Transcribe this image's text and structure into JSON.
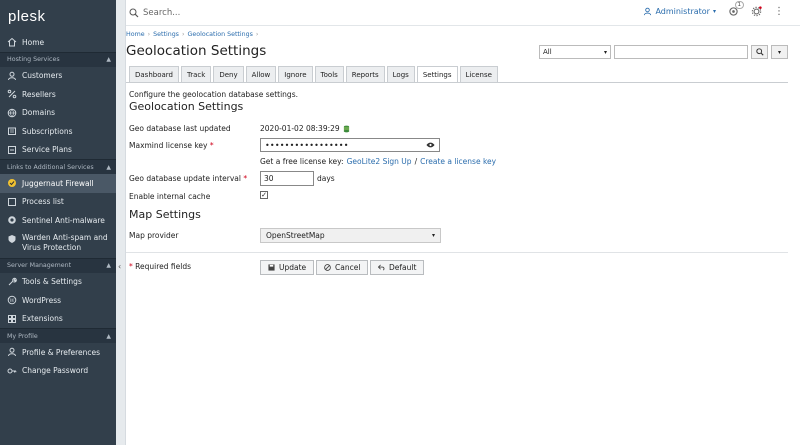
{
  "app": {
    "logo": "plesk"
  },
  "sidebar": {
    "home": "Home",
    "groups": {
      "hosting": "Hosting Services",
      "links": "Links to Additional Services",
      "server": "Server Management",
      "profile": "My Profile"
    },
    "hosting_items": [
      "Customers",
      "Resellers",
      "Domains",
      "Subscriptions",
      "Service Plans"
    ],
    "links_items": [
      "Juggernaut Firewall",
      "Process list",
      "Sentinel Anti-malware",
      "Warden Anti-spam and Virus Protection"
    ],
    "server_items": [
      "Tools & Settings",
      "WordPress",
      "Extensions"
    ],
    "profile_items": [
      "Profile & Preferences",
      "Change Password"
    ]
  },
  "topbar": {
    "search_placeholder": "Search...",
    "user": "Administrator",
    "notification_count": "1"
  },
  "breadcrumbs": [
    "Home",
    "Settings",
    "Geolocation Settings"
  ],
  "page_title": "Geolocation Settings",
  "filter": {
    "selected": "All",
    "value": ""
  },
  "tabs": [
    "Dashboard",
    "Track",
    "Deny",
    "Allow",
    "Ignore",
    "Tools",
    "Reports",
    "Logs",
    "Settings",
    "License"
  ],
  "active_tab": "Settings",
  "form": {
    "description": "Configure the geolocation database settings.",
    "section1": "Geolocation Settings",
    "last_updated_label": "Geo database last updated",
    "last_updated_value": "2020-01-02 08:39:29",
    "license_label": "Maxmind license key",
    "license_value": "•••••••••••••••••",
    "free_key_text": "Get a free license key:",
    "signup_link": "GeoLite2 Sign Up",
    "slash": "/",
    "create_link": "Create a license key",
    "interval_label": "Geo database update interval",
    "interval_value": "30",
    "interval_unit": "days",
    "cache_label": "Enable internal cache",
    "cache_checked": true,
    "section2": "Map Settings",
    "map_label": "Map provider",
    "map_value": "OpenStreetMap",
    "required_note": "Required fields",
    "req_mark": "*"
  },
  "buttons": {
    "update": "Update",
    "cancel": "Cancel",
    "default": "Default"
  },
  "colors": {
    "sidebar_bg": "#323f4b",
    "link": "#2b6dad",
    "required": "#d0021b"
  }
}
